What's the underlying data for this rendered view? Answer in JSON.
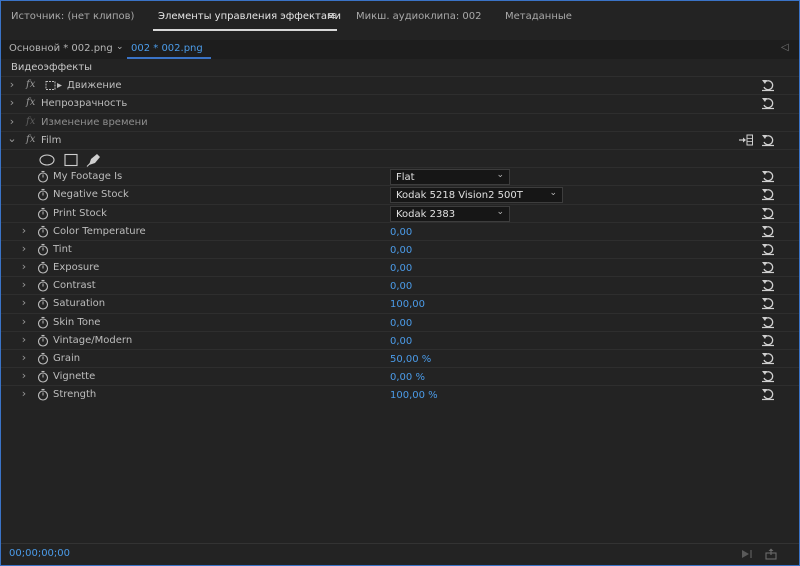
{
  "tabs": [
    {
      "label": "Источник: (нет клипов)",
      "active": false
    },
    {
      "label": "Элементы управления эффектами",
      "active": true
    },
    {
      "label": "Микш. аудиоклипа: 002",
      "active": false
    },
    {
      "label": "Метаданные",
      "active": false
    }
  ],
  "source": {
    "master": "Основной * 002.png",
    "clip": "002 * 002.png"
  },
  "sections": {
    "video_effects": "Видеоэффекты"
  },
  "effects": [
    {
      "label": "Движение",
      "icon": "motion-icon",
      "disabled": false
    },
    {
      "label": "Непрозрачность",
      "disabled": false
    },
    {
      "label": "Изменение времени",
      "disabled": true
    },
    {
      "label": "Film",
      "expanded": true
    }
  ],
  "film_params": [
    {
      "label": "My Footage Is",
      "type": "dropdown",
      "value": "Flat",
      "expandable": false
    },
    {
      "label": "Negative Stock",
      "type": "dropdown",
      "value": "Kodak 5218 Vision2 500T",
      "expandable": false
    },
    {
      "label": "Print Stock",
      "type": "dropdown",
      "value": "Kodak 2383",
      "expandable": false
    },
    {
      "label": "Color Temperature",
      "type": "number",
      "value": "0,00",
      "expandable": true
    },
    {
      "label": "Tint",
      "type": "number",
      "value": "0,00",
      "expandable": true
    },
    {
      "label": "Exposure",
      "type": "number",
      "value": "0,00",
      "expandable": true
    },
    {
      "label": "Contrast",
      "type": "number",
      "value": "0,00",
      "expandable": true
    },
    {
      "label": "Saturation",
      "type": "number",
      "value": "100,00",
      "expandable": true
    },
    {
      "label": "Skin Tone",
      "type": "number",
      "value": "0,00",
      "expandable": true
    },
    {
      "label": "Vintage/Modern",
      "type": "number",
      "value": "0,00",
      "expandable": true
    },
    {
      "label": "Grain",
      "type": "number",
      "value": "50,00 %",
      "expandable": true
    },
    {
      "label": "Vignette",
      "type": "number",
      "value": "0,00 %",
      "expandable": true
    },
    {
      "label": "Strength",
      "type": "number",
      "value": "100,00 %",
      "expandable": true
    }
  ],
  "footer": {
    "timecode": "00;00;00;00"
  },
  "colors": {
    "accent": "#4b9be8",
    "panel_border": "#3a73c6",
    "background": "#232323"
  },
  "icons": [
    "chevron-right-icon",
    "chevron-down-icon",
    "fx-icon",
    "reset-icon",
    "stopwatch-icon",
    "ellipse-mask-icon",
    "rectangle-mask-icon",
    "pen-mask-icon",
    "hamburger-menu-icon",
    "collapse-panel-icon",
    "play-only-icon",
    "export-frame-icon"
  ]
}
